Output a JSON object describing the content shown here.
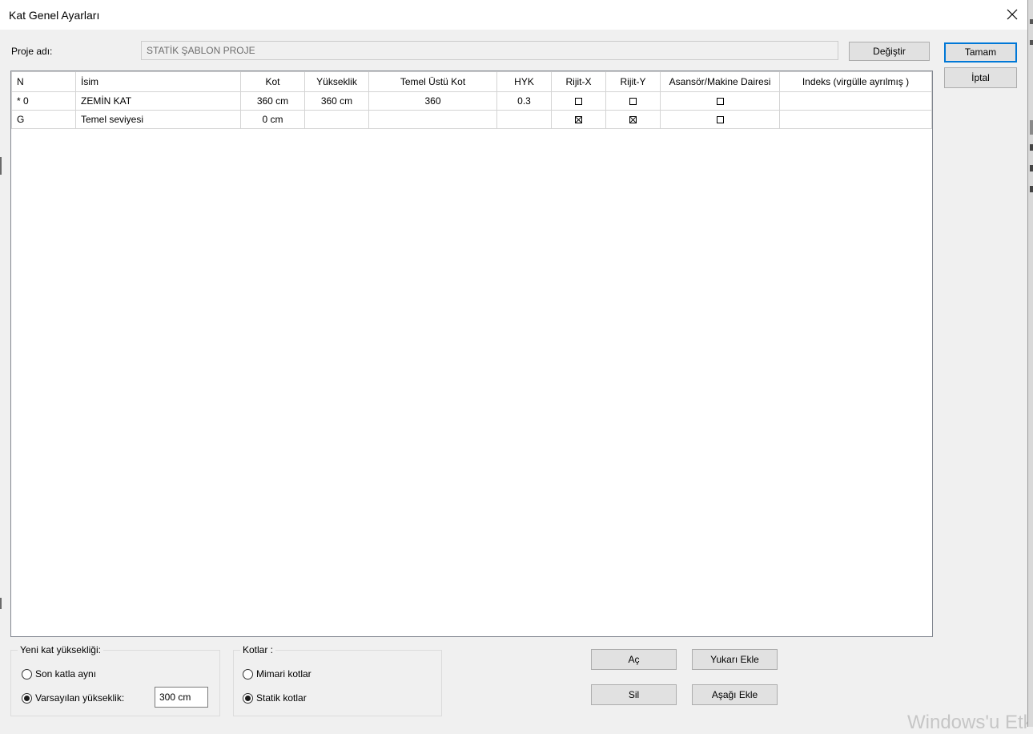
{
  "window": {
    "title": "Kat Genel Ayarları"
  },
  "project": {
    "label": "Proje adı:",
    "name": "STATİK ŞABLON PROJE",
    "change_button": "Değiştir"
  },
  "dialog_buttons": {
    "ok": "Tamam",
    "cancel": "İptal"
  },
  "table": {
    "columns": [
      "N",
      "İsim",
      "Kot",
      "Yükseklik",
      "Temel Üstü Kot",
      "HYK",
      "Rijit-X",
      "Rijit-Y",
      "Asansör/Makine Dairesi",
      "Indeks (virgülle ayrılmış )"
    ],
    "rows": [
      {
        "n": "* 0",
        "isim": "ZEMİN KAT",
        "kot": "360 cm",
        "yukseklik": "360 cm",
        "temel_ustu_kot": "360",
        "hyk": "0.3",
        "rijit_x": false,
        "rijit_y": false,
        "asansor": false,
        "indeks": ""
      },
      {
        "n": "G",
        "isim": "Temel seviyesi",
        "kot": "0 cm",
        "yukseklik": "",
        "temel_ustu_kot": "",
        "hyk": "",
        "rijit_x": true,
        "rijit_y": true,
        "asansor": false,
        "indeks": ""
      }
    ]
  },
  "new_floor_height": {
    "title": "Yeni kat yüksekliği:",
    "option_same": "Son katla aynı",
    "option_default": "Varsayılan yükseklik:",
    "selected": "default",
    "default_value": "300 cm"
  },
  "levels": {
    "title": "Kotlar :",
    "option_arch": "Mimari kotlar",
    "option_static": "Statik kotlar",
    "selected": "static"
  },
  "actions": {
    "open": "Aç",
    "delete": "Sil",
    "add_above": "Yukarı Ekle",
    "add_below": "Aşağı Ekle"
  },
  "watermark": "Windows'u Etk"
}
